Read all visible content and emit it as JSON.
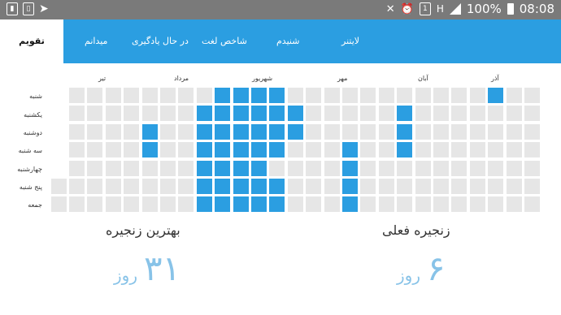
{
  "status_bar": {
    "battery": "100%",
    "time": "08:08",
    "sim_label": "1",
    "network": "H",
    "left_icons": [
      "sim-icon",
      "data-icon",
      "navigation-icon"
    ],
    "right_icons": [
      "mute-icon",
      "alarm-icon",
      "sim-icon",
      "signal-icon",
      "battery-icon"
    ]
  },
  "tabs": [
    {
      "label": "تقویم",
      "active": true
    },
    {
      "label": "میدانم",
      "active": false
    },
    {
      "label": "در حال یادگیری",
      "active": false
    },
    {
      "label": "شاخص لغت",
      "active": false
    },
    {
      "label": "شنیدم",
      "active": false
    },
    {
      "label": "لایتنر",
      "active": false
    }
  ],
  "heatmap": {
    "months": [
      "آذر",
      "آبان",
      "مهر",
      "شهریور",
      "مرداد",
      "تیر"
    ],
    "days": [
      "شنبه",
      "یکشنبه",
      "دوشنبه",
      "سه شنبه",
      "چهارشنبه",
      "پنج شنبه",
      "جمعه"
    ],
    "active_color": "#2b9ee1",
    "inactive_color": "#e6e6e6",
    "columns": 27,
    "first_column_rows": 2,
    "active": [
      [
        2,
        0
      ],
      [
        7,
        1
      ],
      [
        7,
        2
      ],
      [
        7,
        3
      ],
      [
        10,
        3
      ],
      [
        10,
        4
      ],
      [
        10,
        5
      ],
      [
        10,
        6
      ],
      [
        13,
        1
      ],
      [
        13,
        2
      ],
      [
        14,
        0
      ],
      [
        14,
        1
      ],
      [
        14,
        2
      ],
      [
        14,
        3
      ],
      [
        14,
        5
      ],
      [
        14,
        6
      ],
      [
        15,
        0
      ],
      [
        15,
        1
      ],
      [
        15,
        2
      ],
      [
        15,
        3
      ],
      [
        15,
        4
      ],
      [
        15,
        5
      ],
      [
        15,
        6
      ],
      [
        16,
        0
      ],
      [
        16,
        1
      ],
      [
        16,
        2
      ],
      [
        16,
        3
      ],
      [
        16,
        4
      ],
      [
        16,
        5
      ],
      [
        16,
        6
      ],
      [
        17,
        0
      ],
      [
        17,
        1
      ],
      [
        17,
        2
      ],
      [
        17,
        3
      ],
      [
        17,
        4
      ],
      [
        17,
        5
      ],
      [
        17,
        6
      ],
      [
        18,
        1
      ],
      [
        18,
        2
      ],
      [
        18,
        3
      ],
      [
        18,
        4
      ],
      [
        18,
        5
      ],
      [
        18,
        6
      ],
      [
        21,
        2
      ],
      [
        21,
        3
      ]
    ]
  },
  "stats": {
    "best_streak": {
      "title": "بهترین زنجیره",
      "value": "۳۱",
      "unit": "روز"
    },
    "current_streak": {
      "title": "زنجیره فعلی",
      "value": "۶",
      "unit": "روز"
    }
  }
}
